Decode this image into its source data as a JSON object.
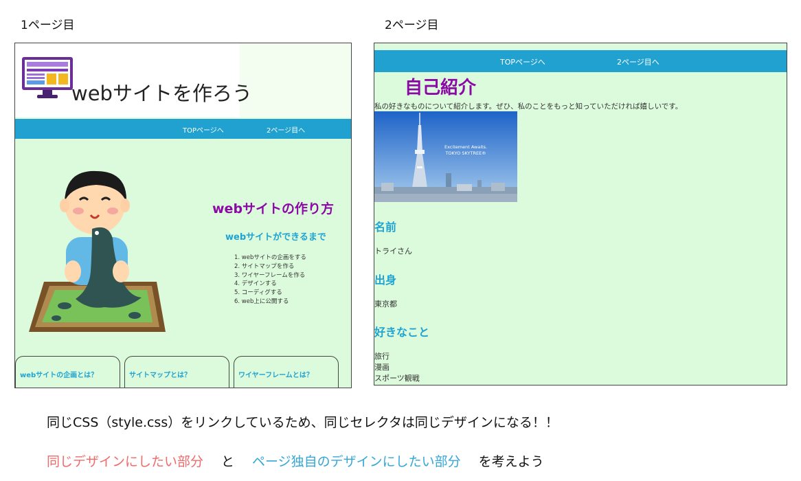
{
  "captions": {
    "page1": "1ページ目",
    "page2": "2ページ目"
  },
  "page1": {
    "header_title": "webサイトを作ろう",
    "nav": {
      "top": "TOPページへ",
      "page2": "2ページ目へ"
    },
    "heading": "webサイトの作り方",
    "subheading": "webサイトができるまで",
    "steps": [
      "1. webサイトの企画をする",
      "2. サイトマップを作る",
      "3. ワイヤーフレームを作る",
      "4. デザインする",
      "5. コーディグする",
      "6. web上に公開する"
    ],
    "cards": [
      "webサイトの企画とは？",
      "サイトマップとは？",
      "ワイヤーフレームとは？"
    ]
  },
  "page2": {
    "nav": {
      "top": "TOPページへ",
      "page2": "2ページ目へ"
    },
    "heading": "自己紹介",
    "intro": "私の好きなものについて紹介します。ぜひ、私のことをもっと知っていただければ嬉しいです。",
    "photo_text": [
      "Excitement Awaits.",
      "TOKYO SKYTREE®"
    ],
    "name_label": "名前",
    "name_value": "トライさん",
    "from_label": "出身",
    "from_value": "東京都",
    "likes_label": "好きなこと",
    "likes": [
      "旅行",
      "漫画",
      "スポーツ観戦"
    ]
  },
  "notes": {
    "line1": "同じCSS（style.css）をリンクしているため、同じセレクタは同じデザインになる！！",
    "line2_a": "同じデザインにしたい部分",
    "line2_b": "と",
    "line2_c": "ページ独自のデザインにしたい部分",
    "line2_d": "を考えよう"
  },
  "colors": {
    "page_bg": "#dcfadc",
    "nav_bg": "#21a1cf",
    "heading_purple": "#8b0aa5",
    "label_blue": "#1fa3d2",
    "note_red": "#f06a6a",
    "note_blue": "#33a7d9"
  },
  "icons": [
    "computer-monitor-icon",
    "boy-clay-illustration",
    "skytree-photo"
  ]
}
